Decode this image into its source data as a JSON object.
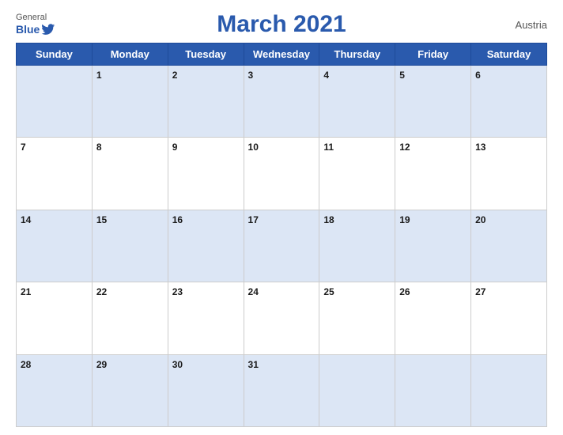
{
  "header": {
    "logo_general": "General",
    "logo_blue": "Blue",
    "title": "March 2021",
    "country": "Austria"
  },
  "weekdays": [
    "Sunday",
    "Monday",
    "Tuesday",
    "Wednesday",
    "Thursday",
    "Friday",
    "Saturday"
  ],
  "weeks": [
    [
      null,
      "1",
      "2",
      "3",
      "4",
      "5",
      "6"
    ],
    [
      "7",
      "8",
      "9",
      "10",
      "11",
      "12",
      "13"
    ],
    [
      "14",
      "15",
      "16",
      "17",
      "18",
      "19",
      "20"
    ],
    [
      "21",
      "22",
      "23",
      "24",
      "25",
      "26",
      "27"
    ],
    [
      "28",
      "29",
      "30",
      "31",
      null,
      null,
      null
    ]
  ]
}
